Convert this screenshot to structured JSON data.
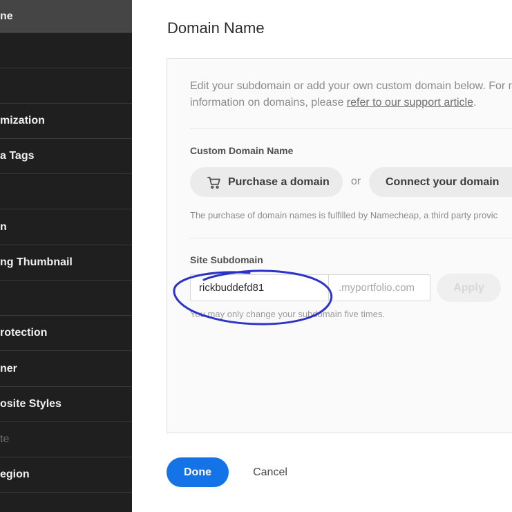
{
  "sidebar": {
    "items": [
      {
        "label": "ne",
        "state": "active"
      },
      {
        "label": "",
        "state": "normal"
      },
      {
        "label": "",
        "state": "normal"
      },
      {
        "label": "mization",
        "state": "normal"
      },
      {
        "label": "a Tags",
        "state": "normal"
      },
      {
        "label": "",
        "state": "normal"
      },
      {
        "label": "n",
        "state": "normal"
      },
      {
        "label": "ng Thumbnail",
        "state": "normal"
      },
      {
        "label": "",
        "state": "normal"
      },
      {
        "label": "rotection",
        "state": "normal"
      },
      {
        "label": "ner",
        "state": "normal"
      },
      {
        "label": "osite Styles",
        "state": "normal"
      },
      {
        "label": "te",
        "state": "disabled"
      },
      {
        "label": "egion",
        "state": "normal"
      },
      {
        "label": "",
        "state": "normal"
      }
    ]
  },
  "page": {
    "title": "Domain Name"
  },
  "info": {
    "text_before": "Edit your subdomain or add your own custom domain below. For more information on domains, please ",
    "link_text": "refer to our support article",
    "text_after": "."
  },
  "custom_domain": {
    "label": "Custom Domain Name",
    "purchase_label": "Purchase a domain",
    "purchase_icon": "cart-icon",
    "or_text": "or",
    "connect_label": "Connect your domain",
    "fineprint": "The purchase of domain names is fulfilled by Namecheap, a third party provic"
  },
  "subdomain": {
    "label": "Site Subdomain",
    "value": "rickbuddefd81",
    "suffix": ".myportfolio.com",
    "apply_label": "Apply",
    "helper": "You may only change your subdomain five times."
  },
  "footer": {
    "done_label": "Done",
    "cancel_label": "Cancel"
  },
  "colors": {
    "sidebar_bg": "#1f1f1f",
    "sidebar_active": "#454545",
    "primary_blue": "#1473e6",
    "annotation_ink": "#2a32c8"
  }
}
